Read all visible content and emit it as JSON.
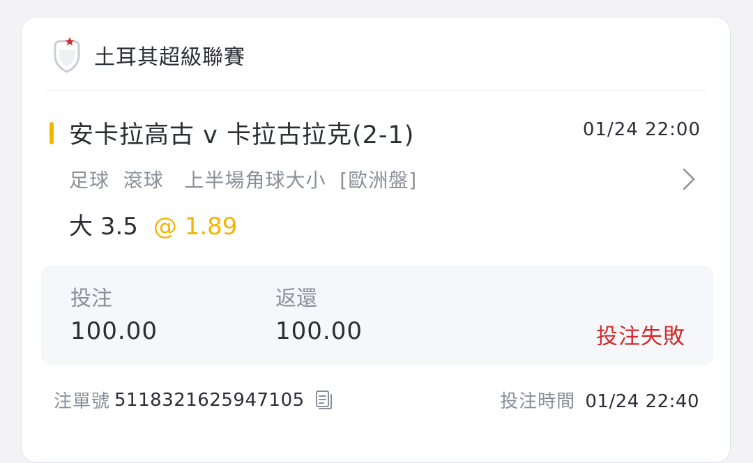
{
  "league": {
    "name": "土耳其超級聯賽",
    "logo_icon": "turkish-league-logo-icon"
  },
  "match": {
    "title": "安卡拉高古 v 卡拉古拉克(2-1)",
    "time": "01/24 22:00",
    "bet_description": "足球  滾球   上半場角球大小  [歐洲盤]",
    "selection": "大 3.5",
    "odds": "@ 1.89"
  },
  "summary": {
    "stake_label": "投注",
    "stake_value": "100.00",
    "return_label": "返還",
    "return_value": "100.00",
    "status": "投注失敗"
  },
  "footer": {
    "order_label": "注單號",
    "order_number": "5118321625947105",
    "bet_time_label": "投注時間",
    "bet_time_value": "01/24 22:40"
  },
  "colors": {
    "accent": "#f5b400",
    "status_fail": "#d22a2a",
    "muted_text": "#8a8f99",
    "primary_text": "#2a2d33"
  }
}
